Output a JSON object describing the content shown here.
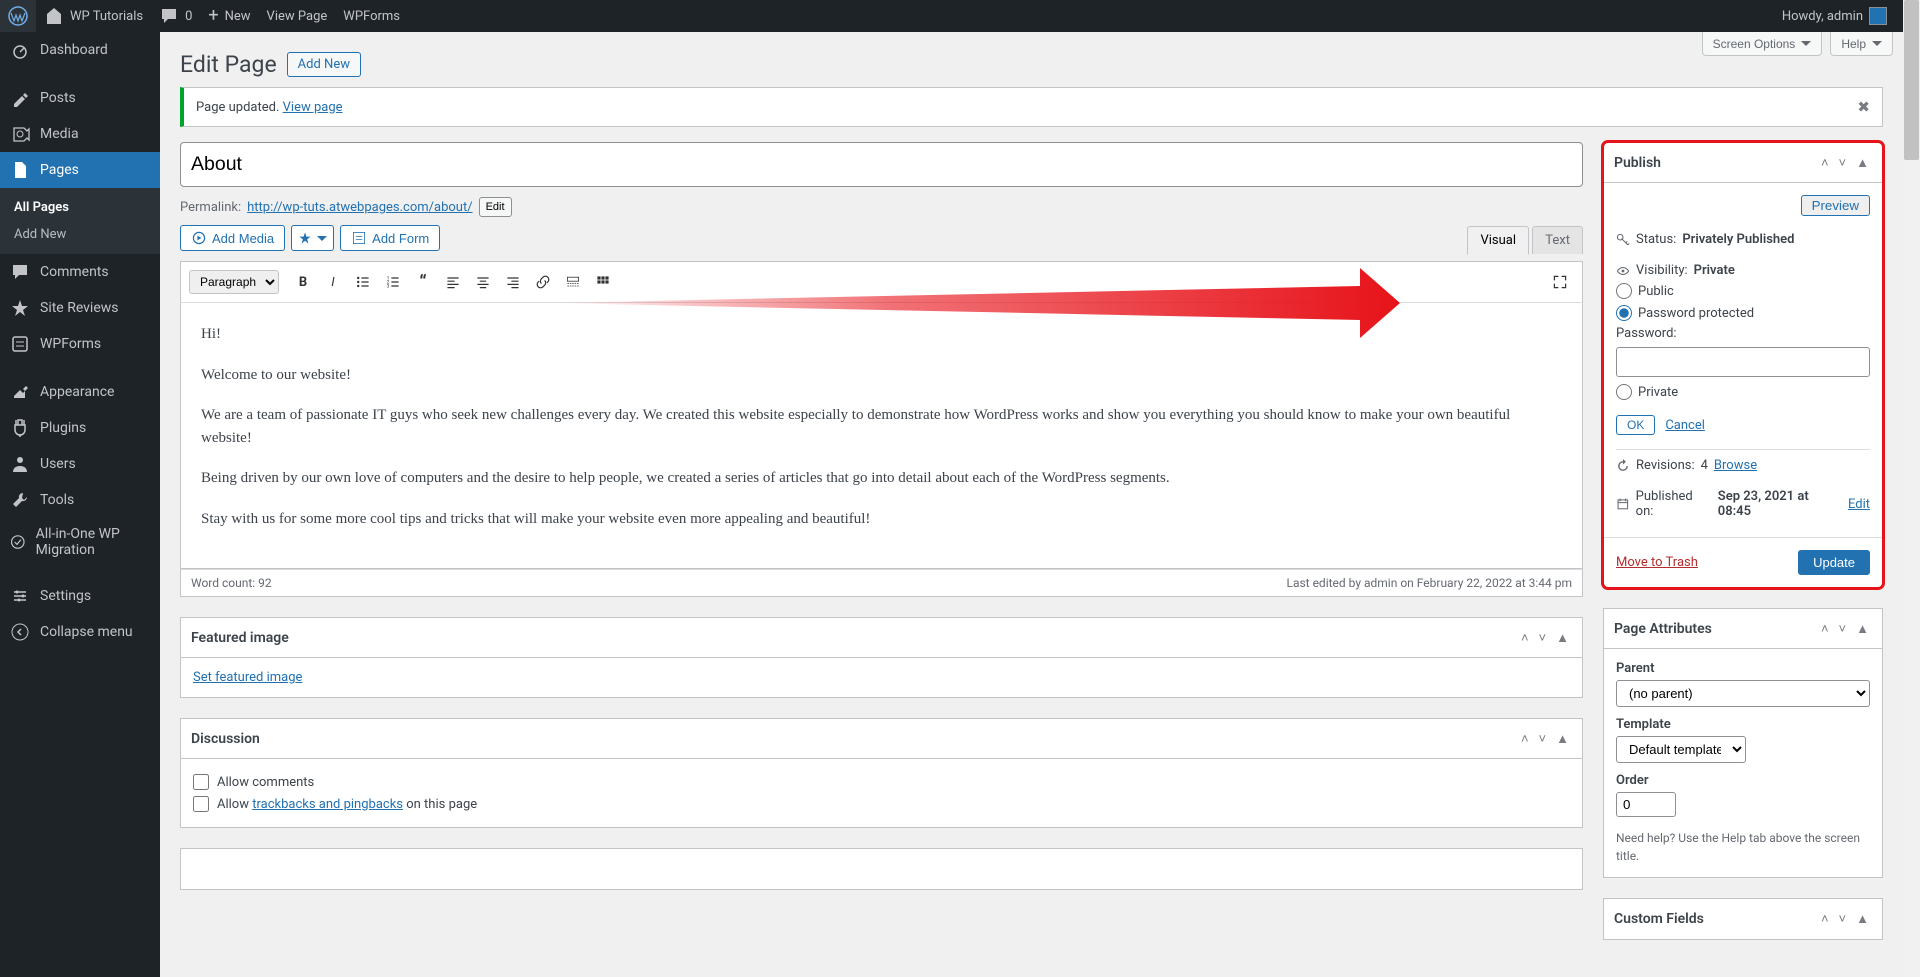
{
  "adminbar": {
    "site_name": "WP Tutorials",
    "comments": "0",
    "new": "New",
    "view_page": "View Page",
    "wpforms": "WPForms",
    "howdy": "Howdy, admin"
  },
  "adminmenu": {
    "dashboard": "Dashboard",
    "posts": "Posts",
    "media": "Media",
    "pages": "Pages",
    "all_pages": "All Pages",
    "add_new": "Add New",
    "comments": "Comments",
    "site_reviews": "Site Reviews",
    "wpforms": "WPForms",
    "appearance": "Appearance",
    "plugins": "Plugins",
    "users": "Users",
    "tools": "Tools",
    "aio_migration": "All-in-One WP Migration",
    "settings": "Settings",
    "collapse": "Collapse menu"
  },
  "topbuttons": {
    "screen_options": "Screen Options",
    "help": "Help"
  },
  "title": {
    "heading": "Edit Page",
    "add_new": "Add New"
  },
  "notice": {
    "message": "Page updated.",
    "link": "View page"
  },
  "editor": {
    "title_value": "About",
    "permalink_label": "Permalink:",
    "permalink_url": "http://wp-tuts.atwebpages.com/about/",
    "permalink_edit": "Edit",
    "add_media": "Add Media",
    "add_form": "Add Form",
    "tab_visual": "Visual",
    "tab_text": "Text",
    "paragraph": "Paragraph",
    "content_p1": "Hi!",
    "content_p2": "Welcome to our website!",
    "content_p3": "We are a team of passionate IT guys who seek new challenges every day. We created this website especially to demonstrate how WordPress works and show you everything you should know to make your own beautiful website!",
    "content_p4": "Being driven by our own love of computers and the desire to help people, we created a series of articles that go into detail about each of the WordPress segments.",
    "content_p5": "Stay with us for some more cool tips and tricks that will make your website even more appealing and beautiful!",
    "word_count": "Word count: 92",
    "last_edited": "Last edited by admin on February 22, 2022 at 3:44 pm"
  },
  "featured_image": {
    "box_title": "Featured image",
    "link": "Set featured image"
  },
  "discussion": {
    "box_title": "Discussion",
    "allow_comments": "Allow comments",
    "allow_prefix": "Allow ",
    "trackbacks_link": "trackbacks and pingbacks",
    "allow_suffix": " on this page"
  },
  "publish": {
    "box_title": "Publish",
    "preview": "Preview",
    "status_label": "Status:",
    "status_value": "Privately Published",
    "visibility_label": "Visibility:",
    "visibility_value": "Private",
    "radio_public": "Public",
    "radio_password": "Password protected",
    "password_label": "Password:",
    "radio_private": "Private",
    "ok": "OK",
    "cancel": "Cancel",
    "revisions_label": "Revisions:",
    "revisions_count": "4",
    "browse": "Browse",
    "published_label": "Published on:",
    "published_value": "Sep 23, 2021 at 08:45",
    "edit": "Edit",
    "move_trash": "Move to Trash",
    "update": "Update"
  },
  "page_attributes": {
    "box_title": "Page Attributes",
    "parent_label": "Parent",
    "parent_value": "(no parent)",
    "template_label": "Template",
    "template_value": "Default template",
    "order_label": "Order",
    "order_value": "0",
    "help": "Need help? Use the Help tab above the screen title."
  },
  "custom_fields": {
    "box_title": "Custom Fields"
  }
}
